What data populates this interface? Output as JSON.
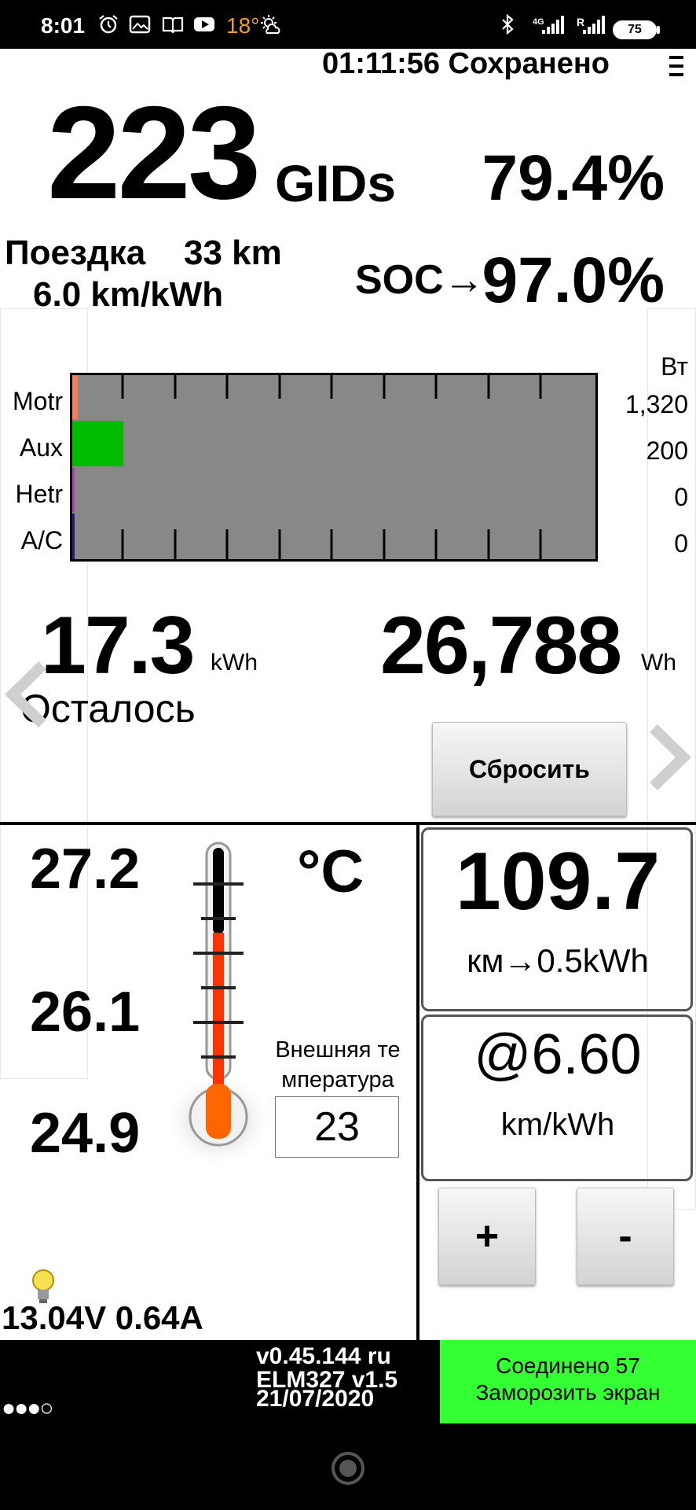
{
  "status_bar": {
    "time": "8:01",
    "temperature": "18°",
    "battery": "75",
    "net_4g": "4G",
    "roaming": "R"
  },
  "header": {
    "timer_status": "01:11:56 Сохранено",
    "menu_icon": "overflow-menu-icon"
  },
  "gids": {
    "value": "223",
    "unit": "GIDs",
    "percent": "79.4%"
  },
  "trip": {
    "label": "Поездка",
    "distance": "33 km",
    "efficiency": "6.0 km/kWh"
  },
  "soc": {
    "label": "SOC→",
    "value": "97.0%"
  },
  "power_chart": {
    "unit": "Вт",
    "rows": [
      {
        "label": "Motr",
        "value": "1,320",
        "color": "#f08060"
      },
      {
        "label": "Aux",
        "value": "200",
        "color": "#00bb00"
      },
      {
        "label": "Hetr",
        "value": "0",
        "color": "#aa44aa"
      },
      {
        "label": "A/C",
        "value": "0",
        "color": "#202080"
      }
    ]
  },
  "energy": {
    "remaining_value": "17.3",
    "remaining_unit": "kWh",
    "remaining_label": "Осталось",
    "wh_value": "26,788",
    "wh_unit": "Wh",
    "reset_label": "Сбросить"
  },
  "temperature": {
    "readings": [
      "27.2",
      "26.1",
      "24.9"
    ],
    "unit": "°C",
    "outside_label": "Внешняя те мпература",
    "outside_value": "23"
  },
  "range": {
    "value": "109.7",
    "subtitle": "км→0.5kWh",
    "efficiency_value": "@6.60",
    "efficiency_unit": "km/kWh",
    "plus_label": "+",
    "minus_label": "-"
  },
  "electrical": {
    "reading": "13.04V 0.64A"
  },
  "footer": {
    "version_line1": "v0.45.144 ru",
    "version_line2": "ELM327 v1.5",
    "version_line3": "21/07/2020",
    "connection": "Соединено 57",
    "freeze": "Заморозить экран",
    "dots": "●●●○"
  },
  "colors": {
    "chart_bg": "#888888",
    "connected_bg": "#33ff33",
    "thermo_red": "#ff3300",
    "thermo_bulb": "#ff6600"
  }
}
